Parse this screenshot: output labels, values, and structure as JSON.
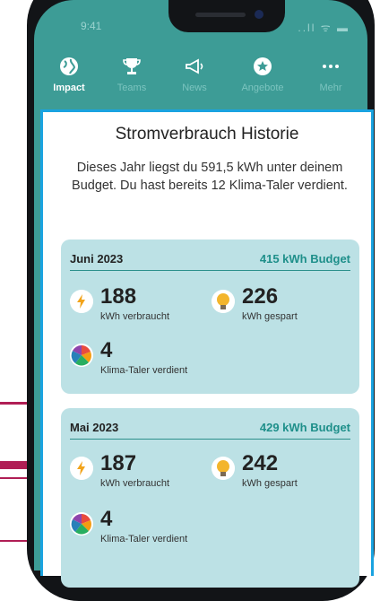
{
  "status": {
    "time": "9:41",
    "icons": "..ll ᯤ ▬"
  },
  "tabs": [
    {
      "label": "Impact",
      "icon": "globe-icon"
    },
    {
      "label": "Teams",
      "icon": "trophy-icon"
    },
    {
      "label": "News",
      "icon": "megaphone-icon"
    },
    {
      "label": "Angebote",
      "icon": "star-icon"
    },
    {
      "label": "Mehr",
      "icon": "more-icon"
    }
  ],
  "panel": {
    "title": "Stromverbrauch Historie",
    "intro": "Dieses Jahr liegst du 591,5 kWh unter deinem Budget. Du hast bereits 12 Klima-Taler verdient."
  },
  "months": [
    {
      "month": "Juni 2023",
      "budget": "415 kWh Budget",
      "used_value": "188",
      "used_label": "kWh verbraucht",
      "saved_value": "226",
      "saved_label": "kWh gespart",
      "coins_value": "4",
      "coins_label": "Klima-Taler verdient"
    },
    {
      "month": "Mai 2023",
      "budget": "429 kWh Budget",
      "used_value": "187",
      "used_label": "kWh verbraucht",
      "saved_value": "242",
      "saved_label": "kWh gespart",
      "coins_value": "4",
      "coins_label": "Klima-Taler verdient"
    }
  ],
  "colors": {
    "teal": "#3d9c96",
    "card": "#bce1e5",
    "accent": "#1e8f8a",
    "border": "#1aa3e0"
  }
}
